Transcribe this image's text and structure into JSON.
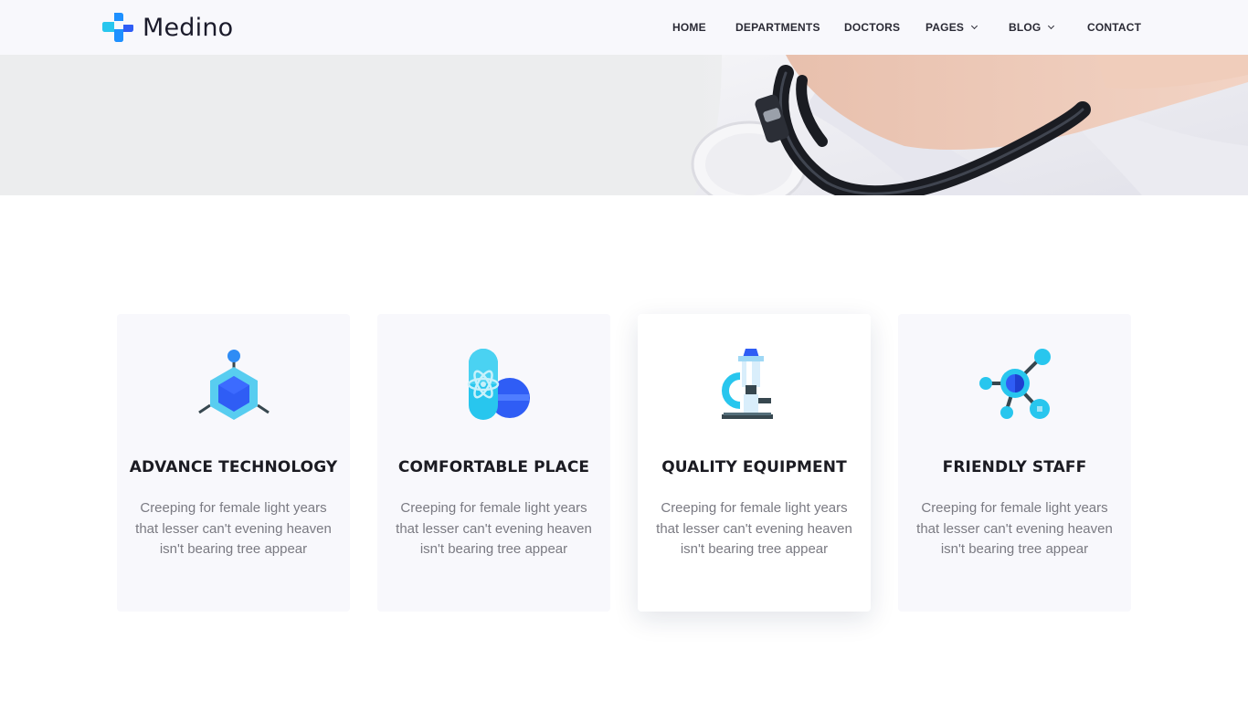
{
  "brand": {
    "name": "Medino"
  },
  "nav": {
    "items": [
      {
        "label": "HOME"
      },
      {
        "label": "DEPARTMENTS"
      },
      {
        "label": "DOCTORS"
      },
      {
        "label": "PAGES"
      },
      {
        "label": "BLOG"
      },
      {
        "label": "CONTACT"
      }
    ]
  },
  "features": [
    {
      "title": "ADVANCE TECHNOLOGY",
      "text": "Creeping for female light years that lesser can't evening heaven isn't bearing tree appear",
      "icon": "molecule-hexagon-icon"
    },
    {
      "title": "COMFORTABLE PLACE",
      "text": "Creeping for female light years that lesser can't evening heaven isn't bearing tree appear",
      "icon": "pill-atom-icon"
    },
    {
      "title": "QUALITY EQUIPMENT",
      "text": "Creeping for female light years that lesser can't evening heaven isn't bearing tree appear",
      "icon": "microscope-icon"
    },
    {
      "title": "FRIENDLY STAFF",
      "text": "Creeping for female light years that lesser can't evening heaven isn't bearing tree appear",
      "icon": "network-nodes-icon"
    }
  ],
  "colors": {
    "accent_blue": "#2f5df5",
    "accent_cyan": "#28c6ee",
    "light_cyan": "#9fe3f7",
    "text_dark": "#1b1b22",
    "text_muted": "#7a7a82",
    "card_bg": "#f8f8fc"
  }
}
